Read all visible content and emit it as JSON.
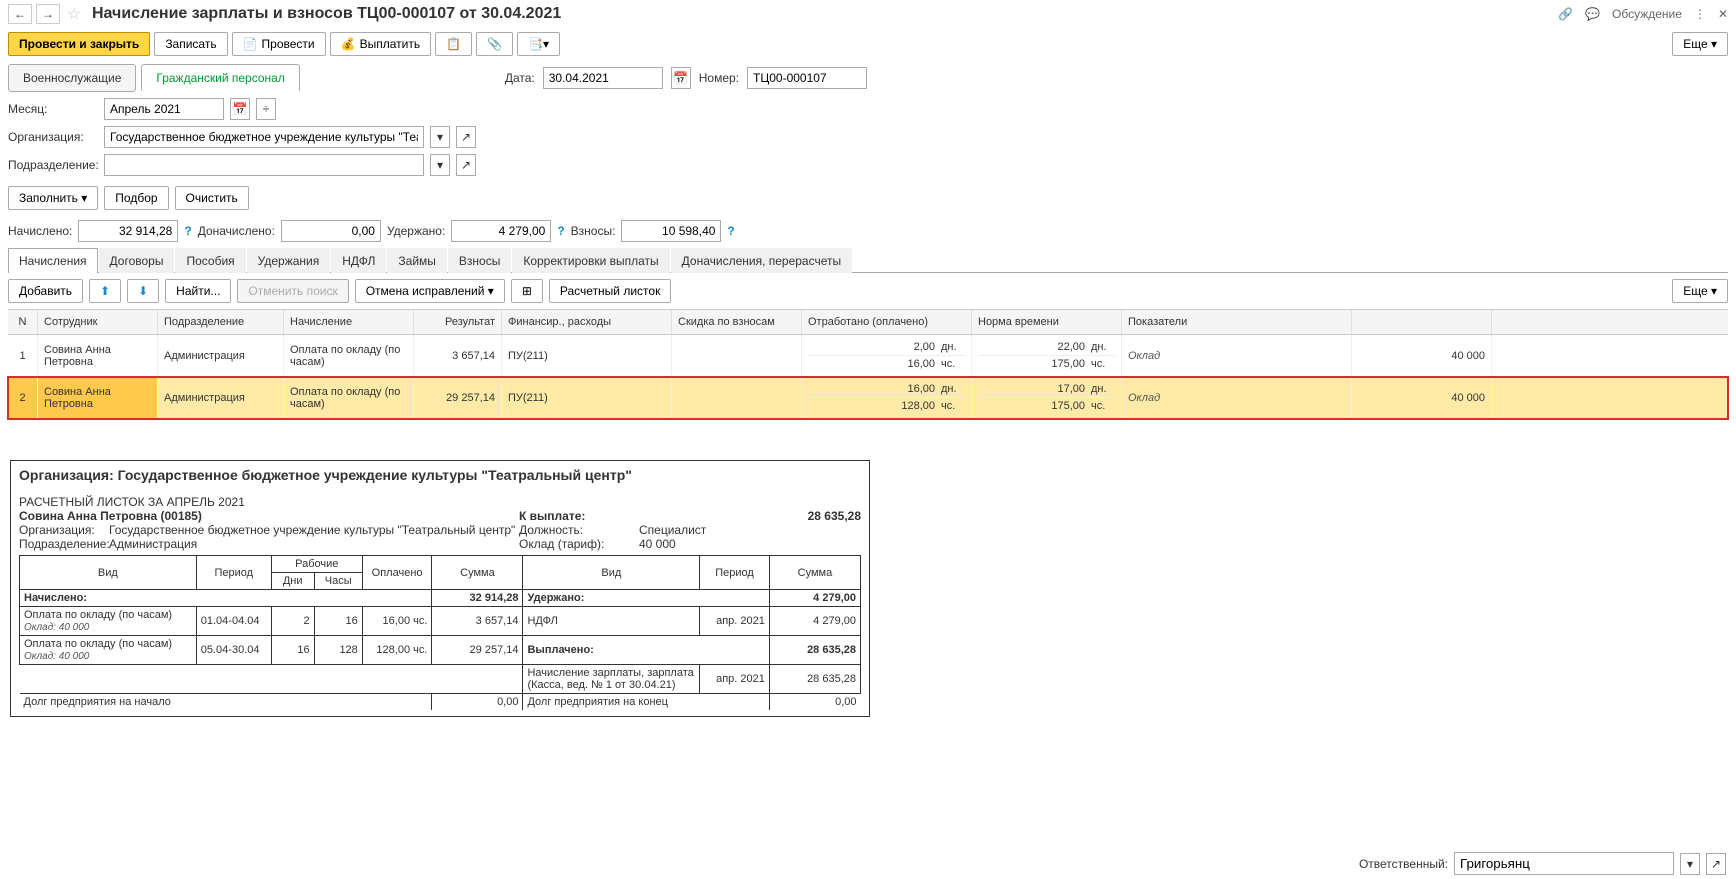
{
  "header": {
    "title": "Начисление зарплаты и взносов ТЦ00-000107 от 30.04.2021",
    "discuss_label": "Обсуждение"
  },
  "toolbar": {
    "post_close": "Провести и закрыть",
    "write": "Записать",
    "post": "Провести",
    "pay": "Выплатить",
    "more": "Еще"
  },
  "persontabs": {
    "military": "Военнослужащие",
    "civilian": "Гражданский персонал",
    "date_label": "Дата:",
    "date_value": "30.04.2021",
    "num_label": "Номер:",
    "num_value": "ТЦ00-000107"
  },
  "fields": {
    "month_label": "Месяц:",
    "month_value": "Апрель 2021",
    "org_label": "Организация:",
    "org_value": "Государственное бюджетное учреждение культуры \"Театральный центр\"",
    "dept_label": "Подразделение:",
    "dept_value": ""
  },
  "actions": {
    "fill": "Заполнить",
    "pick": "Подбор",
    "clear": "Очистить"
  },
  "totals": {
    "accrued_label": "Начислено:",
    "accrued": "32 914,28",
    "extra_label": "Доначислено:",
    "extra": "0,00",
    "withheld_label": "Удержано:",
    "withheld": "4 279,00",
    "contrib_label": "Взносы:",
    "contrib": "10 598,40"
  },
  "datatabs": [
    "Начисления",
    "Договоры",
    "Пособия",
    "Удержания",
    "НДФЛ",
    "Займы",
    "Взносы",
    "Корректировки выплаты",
    "Доначисления, перерасчеты"
  ],
  "gridtoolbar": {
    "add": "Добавить",
    "find": "Найти...",
    "cancel_search": "Отменить поиск",
    "cancel_fix": "Отмена исправлений",
    "slip": "Расчетный листок",
    "more": "Еще"
  },
  "gridheader": {
    "n": "N",
    "emp": "Сотрудник",
    "dep": "Подразделение",
    "acc": "Начисление",
    "res": "Результат",
    "fin": "Финансир., расходы",
    "disc": "Скидка по взносам",
    "work": "Отработано (оплачено)",
    "norm": "Норма времени",
    "ind": "Показатели"
  },
  "rows": [
    {
      "n": "1",
      "emp": "Совина Анна Петровна",
      "dep": "Администрация",
      "acc": "Оплата по окладу (по часам)",
      "res": "3 657,14",
      "fin": "ПУ(211)",
      "work_days": "2,00",
      "work_d_u": "дн.",
      "work_hours": "16,00",
      "work_h_u": "чс.",
      "norm_days": "22,00",
      "norm_d_u": "дн.",
      "norm_hours": "175,00",
      "norm_h_u": "чс.",
      "ind": "Оклад",
      "val": "40 000"
    },
    {
      "n": "2",
      "emp": "Совина Анна Петровна",
      "dep": "Администрация",
      "acc": "Оплата по окладу (по часам)",
      "res": "29 257,14",
      "fin": "ПУ(211)",
      "work_days": "16,00",
      "work_d_u": "дн.",
      "work_hours": "128,00",
      "work_h_u": "чс.",
      "norm_days": "17,00",
      "norm_d_u": "дн.",
      "norm_hours": "175,00",
      "norm_h_u": "чс.",
      "ind": "Оклад",
      "val": "40 000"
    }
  ],
  "slip": {
    "org_heading": "Организация: Государственное бюджетное учреждение культуры \"Театральный центр\"",
    "title": "РАСЧЕТНЫЙ ЛИСТОК ЗА АПРЕЛЬ 2021",
    "emp": "Совина Анна Петровна (00185)",
    "topay_label": "К выплате:",
    "topay": "28 635,28",
    "org_label": "Организация:",
    "org_value": "Государственное бюджетное учреждение культуры \"Театральный центр\"",
    "dept_label": "Подразделение:",
    "dept_value": "Администрация",
    "pos_label": "Должность:",
    "pos_value": "Специалист",
    "sal_label": "Оклад (тариф):",
    "sal_value": "40 000",
    "th": {
      "vid": "Вид",
      "period": "Период",
      "work": "Рабочие",
      "days": "Дни",
      "hours": "Часы",
      "paid": "Оплачено",
      "sum": "Сумма"
    },
    "accrued_label": "Начислено:",
    "accrued_sum": "32 914,28",
    "withheld_label": "Удержано:",
    "withheld_sum": "4 279,00",
    "acc_rows": [
      {
        "vid": "Оплата по окладу (по часам)",
        "sub": "Оклад: 40 000",
        "period": "01.04-04.04",
        "days": "2",
        "hours": "16",
        "paid": "16,00 чс.",
        "sum": "3 657,14"
      },
      {
        "vid": "Оплата по окладу (по часам)",
        "sub": "Оклад: 40 000",
        "period": "05.04-30.04",
        "days": "16",
        "hours": "128",
        "paid": "128,00 чс.",
        "sum": "29 257,14"
      }
    ],
    "wh_rows": [
      {
        "vid": "НДФЛ",
        "period": "апр. 2021",
        "sum": "4 279,00"
      }
    ],
    "paid_label": "Выплачено:",
    "paid_sum": "28 635,28",
    "paid_rows": [
      {
        "vid": "Начисление зарплаты, зарплата (Касса, вед. № 1 от 30.04.21)",
        "period": "апр. 2021",
        "sum": "28 635,28"
      }
    ],
    "debt_start_label": "Долг предприятия на начало",
    "debt_start": "0,00",
    "debt_end_label": "Долг предприятия на конец",
    "debt_end": "0,00"
  },
  "footer": {
    "resp_label": "Ответственный:",
    "resp_value": "Григорьянц"
  }
}
